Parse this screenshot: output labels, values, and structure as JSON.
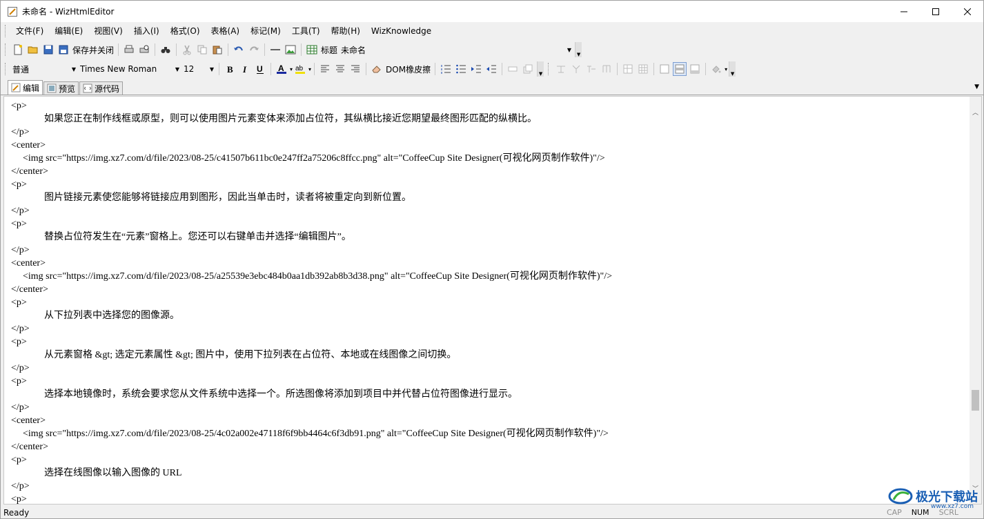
{
  "window": {
    "title": "未命名 - WizHtmlEditor"
  },
  "menubar": {
    "items": [
      "文件(F)",
      "编辑(E)",
      "视图(V)",
      "插入(I)",
      "格式(O)",
      "表格(A)",
      "标记(M)",
      "工具(T)",
      "帮助(H)",
      "WizKnowledge"
    ]
  },
  "toolbar1": {
    "save_close_label": "保存并关闭",
    "title_label": "标题",
    "title_value": "未命名"
  },
  "toolbar2": {
    "paragraph_style": "普通",
    "font_family": "Times New Roman",
    "font_size": "12",
    "dom_eraser_label": "DOM橡皮擦"
  },
  "tabs": [
    "编辑",
    "预览",
    "源代码"
  ],
  "editor": {
    "lines": [
      {
        "text": "<p>",
        "indent": 0
      },
      {
        "text": "如果您正在制作线框或原型，则可以使用图片元素变体来添加占位符，其纵横比接近您期望最终图形匹配的纵横比。",
        "indent": 2
      },
      {
        "text": "</p>",
        "indent": 0
      },
      {
        "text": "<center>",
        "indent": 0
      },
      {
        "text": "<img src=\"https://img.xz7.com/d/file/2023/08-25/c41507b611bc0e247ff2a75206c8ffcc.png\" alt=\"CoffeeCup Site Designer(可视化网页制作软件)\"/>",
        "indent": 1
      },
      {
        "text": "</center>",
        "indent": 0
      },
      {
        "text": "<p>",
        "indent": 0
      },
      {
        "text": "图片链接元素使您能够将链接应用到图形，因此当单击时，读者将被重定向到新位置。",
        "indent": 2
      },
      {
        "text": "</p>",
        "indent": 0
      },
      {
        "text": "<p>",
        "indent": 0
      },
      {
        "text": "替换占位符发生在“元素”窗格上。您还可以右键单击并选择“编辑图片”。",
        "indent": 2
      },
      {
        "text": "</p>",
        "indent": 0
      },
      {
        "text": "<center>",
        "indent": 0
      },
      {
        "text": "<img src=\"https://img.xz7.com/d/file/2023/08-25/a25539e3ebc484b0aa1db392ab8b3d38.png\" alt=\"CoffeeCup Site Designer(可视化网页制作软件)\"/>",
        "indent": 1
      },
      {
        "text": "</center>",
        "indent": 0
      },
      {
        "text": "<p>",
        "indent": 0
      },
      {
        "text": "从下拉列表中选择您的图像源。",
        "indent": 2
      },
      {
        "text": "</p>",
        "indent": 0
      },
      {
        "text": "<p>",
        "indent": 0
      },
      {
        "text": "从元素窗格 &gt; 选定元素属性 &gt; 图片中，使用下拉列表在占位符、本地或在线图像之间切换。",
        "indent": 2
      },
      {
        "text": "</p>",
        "indent": 0
      },
      {
        "text": "<p>",
        "indent": 0
      },
      {
        "text": "选择本地镜像时，系统会要求您从文件系统中选择一个。所选图像将添加到项目中并代替占位符图像进行显示。",
        "indent": 2
      },
      {
        "text": "</p>",
        "indent": 0
      },
      {
        "text": "<center>",
        "indent": 0
      },
      {
        "text": "<img src=\"https://img.xz7.com/d/file/2023/08-25/4c02a002e47118f6f9bb4464c6f3db91.png\" alt=\"CoffeeCup Site Designer(可视化网页制作软件)\"/>",
        "indent": 1
      },
      {
        "text": "</center>",
        "indent": 0
      },
      {
        "text": "<p>",
        "indent": 0
      },
      {
        "text": "选择在线图像以输入图像的 URL",
        "indent": 2
      },
      {
        "text": "</p>",
        "indent": 0
      },
      {
        "text": "<p>",
        "indent": 0
      }
    ]
  },
  "statusbar": {
    "status": "Ready",
    "cap": "CAP",
    "num": "NUM",
    "scrl": "SCRL"
  },
  "watermark": {
    "text": "极光下载站",
    "url": "www.xz7.com"
  },
  "colors": {
    "accent": "#1a5fb4",
    "titlebar_bg": "#ffffff",
    "chrome_bg": "#f0f0f0"
  }
}
